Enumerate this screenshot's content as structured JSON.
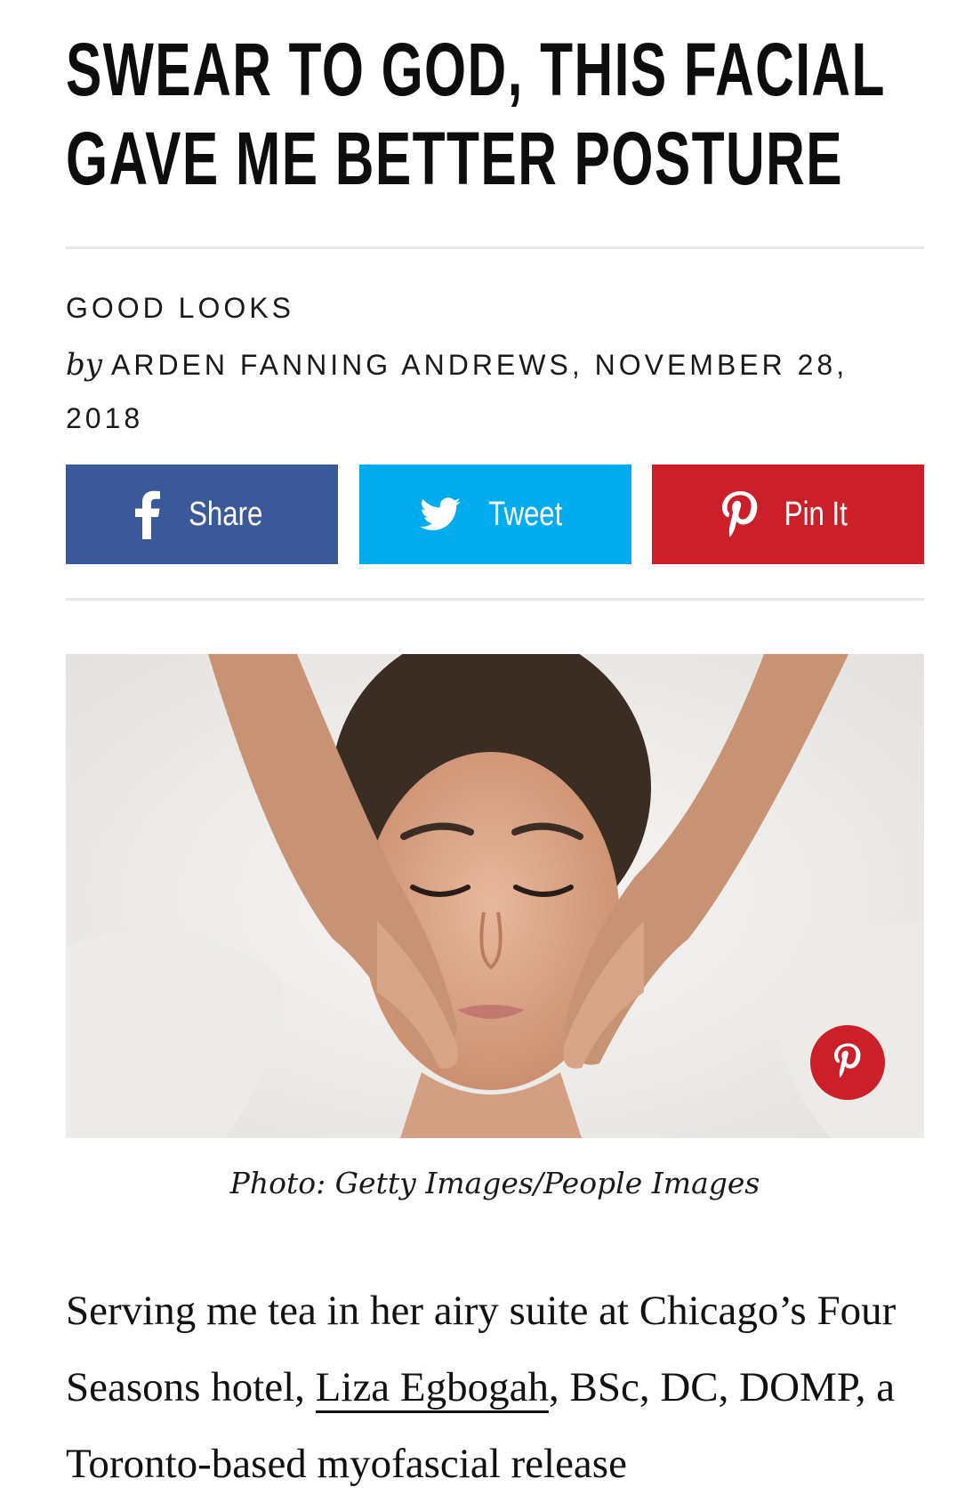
{
  "article": {
    "headline": "SWEAR TO GOD, THIS FACIAL GAVE ME BETTER POSTURE",
    "category": "GOOD LOOKS",
    "byline_prefix": "by",
    "author_date": "ARDEN FANNING ANDREWS, NOVEMBER 28, 2018"
  },
  "share": {
    "facebook_label": "Share",
    "twitter_label": "Tweet",
    "pinterest_label": "Pin It",
    "icons": [
      "facebook-icon",
      "twitter-icon",
      "pinterest-icon"
    ],
    "colors": {
      "facebook": "#3b5998",
      "twitter": "#00acee",
      "pinterest": "#cb1f2a"
    }
  },
  "hero": {
    "caption": "Photo: Getty Images/People Images",
    "pin_icon": "pinterest-icon"
  },
  "body": {
    "p1_before": "Serving me tea in her airy suite at Chicago’s Four Seasons hotel, ",
    "p1_link": "Liza Egbogah",
    "p1_after": ", BSc, DC, DOMP, a Toronto-based myofascial release"
  }
}
